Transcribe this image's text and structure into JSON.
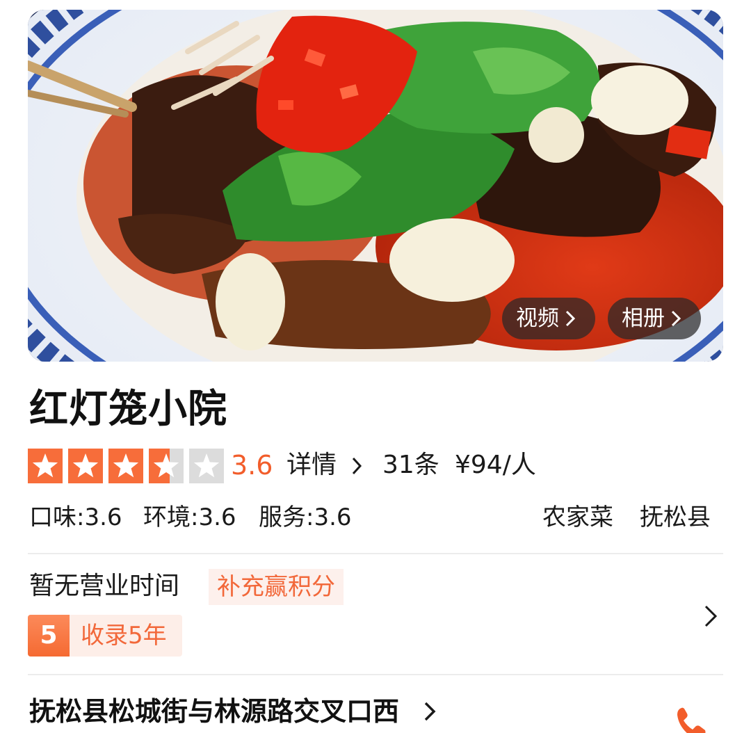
{
  "hero": {
    "video_label": "视频",
    "album_label": "相册"
  },
  "shop": {
    "name": "红灯笼小院",
    "rating": {
      "score": "3.6",
      "stars_value": 3.6,
      "stars_max": 5,
      "star_color": "#f76d3a",
      "detail_label": "详情",
      "review_count": "31条",
      "price_per_person": "¥94/人"
    },
    "sub_scores": {
      "taste": "口味:3.6",
      "environment": "环境:3.6",
      "service": "服务:3.6"
    },
    "category": "农家菜",
    "area": "抚松县"
  },
  "info": {
    "hours": "暂无营业时间",
    "supplement_label": "补充赢积分",
    "badge_number": "5",
    "badge_text": "收录5年"
  },
  "address": {
    "text": "抚松县松城街与林源路交叉口西"
  },
  "colors": {
    "accent": "#f25d2b",
    "badge_bg": "#fdeee8",
    "button_bg": "rgba(40,40,40,0.72)"
  }
}
